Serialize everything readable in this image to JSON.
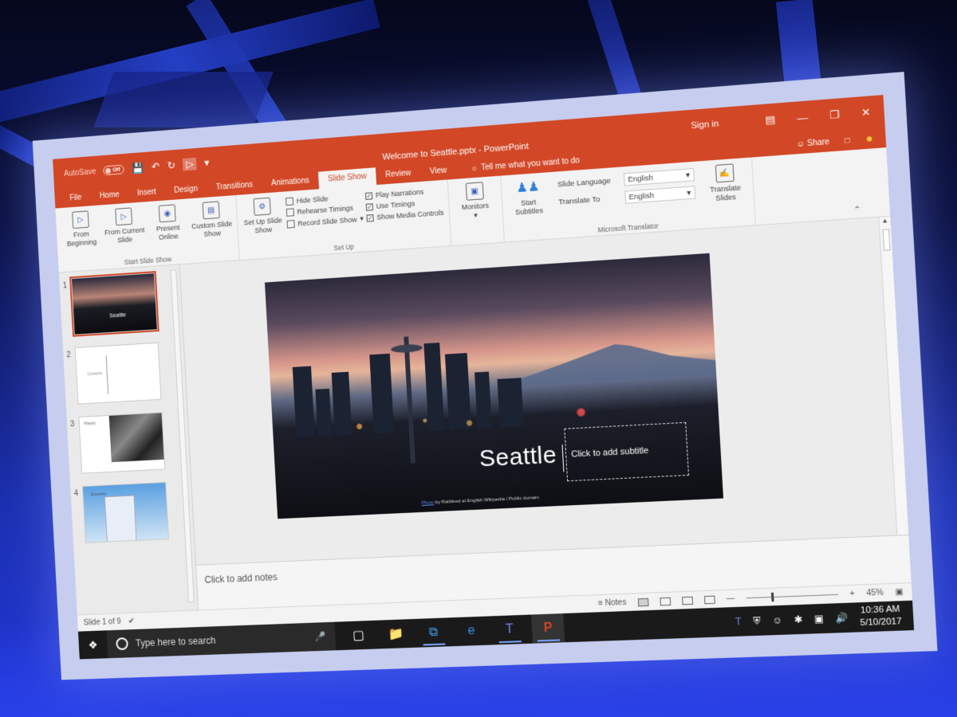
{
  "window": {
    "doc_title": "Welcome to Seattle.pptx  -  PowerPoint",
    "autosave_label": "AutoSave",
    "autosave_state": "Off",
    "sign_in": "Sign in",
    "share": "Share"
  },
  "tabs": [
    "File",
    "Home",
    "Insert",
    "Design",
    "Transitions",
    "Animations",
    "Slide Show",
    "Review",
    "View"
  ],
  "active_tab": "Slide Show",
  "tell_me": "Tell me what you want to do",
  "ribbon": {
    "start_group": {
      "label": "Start Slide Show",
      "from_beginning": "From Beginning",
      "from_current": "From Current Slide",
      "present_online": "Present Online",
      "custom_show": "Custom Slide Show"
    },
    "setup_group": {
      "label": "Set Up",
      "setup_show": "Set Up Slide Show",
      "hide_slide": "Hide Slide",
      "rehearse": "Rehearse Timings",
      "record": "Record Slide Show",
      "play_narrations": "Play Narrations",
      "use_timings": "Use Timings",
      "show_media": "Show Media Controls"
    },
    "monitors": "Monitors",
    "translator_group": {
      "label": "Microsoft Translator",
      "start_subtitles": "Start Subtitles",
      "slide_language_label": "Slide Language",
      "slide_language_value": "English",
      "translate_to_label": "Translate To",
      "translate_to_value": "English",
      "translate_slides": "Translate Slides"
    }
  },
  "thumbnails": [
    {
      "num": "1",
      "title": "Seattle"
    },
    {
      "num": "2",
      "title": "Contents"
    },
    {
      "num": "3",
      "title": "History"
    },
    {
      "num": "4",
      "title": "Economy"
    }
  ],
  "slide": {
    "title": "Seattle",
    "subtitle_placeholder": "Click to add subtitle",
    "credit_link": "Photo",
    "credit_text": "by Rattifeed at English Wikipedia / Public domain"
  },
  "notes_placeholder": "Click to add notes",
  "status": {
    "slide_counter": "Slide 1 of 9",
    "notes": "Notes",
    "zoom": "45%"
  },
  "taskbar": {
    "search_placeholder": "Type here to search",
    "time": "10:36 AM",
    "date": "5/10/2017"
  },
  "colors": {
    "accent": "#d24726",
    "taskbar": "#1a1a1a"
  }
}
